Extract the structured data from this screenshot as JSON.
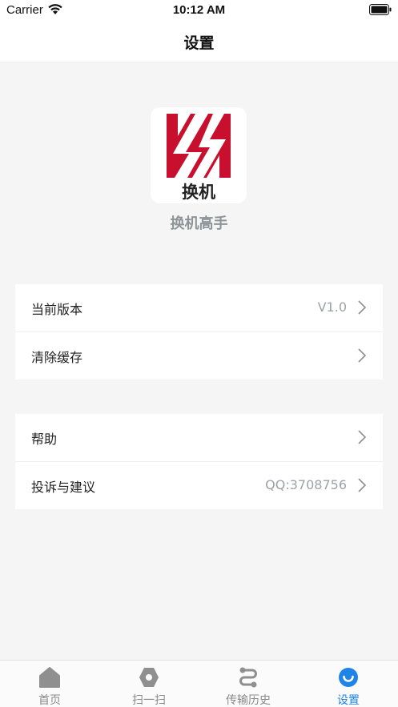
{
  "status_bar": {
    "carrier": "Carrier",
    "time": "10:12 AM"
  },
  "nav": {
    "title": "设置"
  },
  "app": {
    "logo_text": "换机",
    "name": "换机高手",
    "brand_color": "#c8102e"
  },
  "settings": {
    "group1": [
      {
        "label": "当前版本",
        "value": "V1.0"
      },
      {
        "label": "清除缓存",
        "value": ""
      }
    ],
    "group2": [
      {
        "label": "帮助",
        "value": ""
      },
      {
        "label": "投诉与建议",
        "value": "QQ:3708756"
      }
    ]
  },
  "tab_bar": {
    "items": [
      {
        "label": "首页",
        "icon": "home-icon"
      },
      {
        "label": "扫一扫",
        "icon": "scan-icon"
      },
      {
        "label": "传输历史",
        "icon": "transfer-history-icon"
      },
      {
        "label": "设置",
        "icon": "settings-smile-icon"
      }
    ],
    "active_index": 3,
    "active_color": "#1f84e8",
    "inactive_color": "#8a8a8a"
  }
}
